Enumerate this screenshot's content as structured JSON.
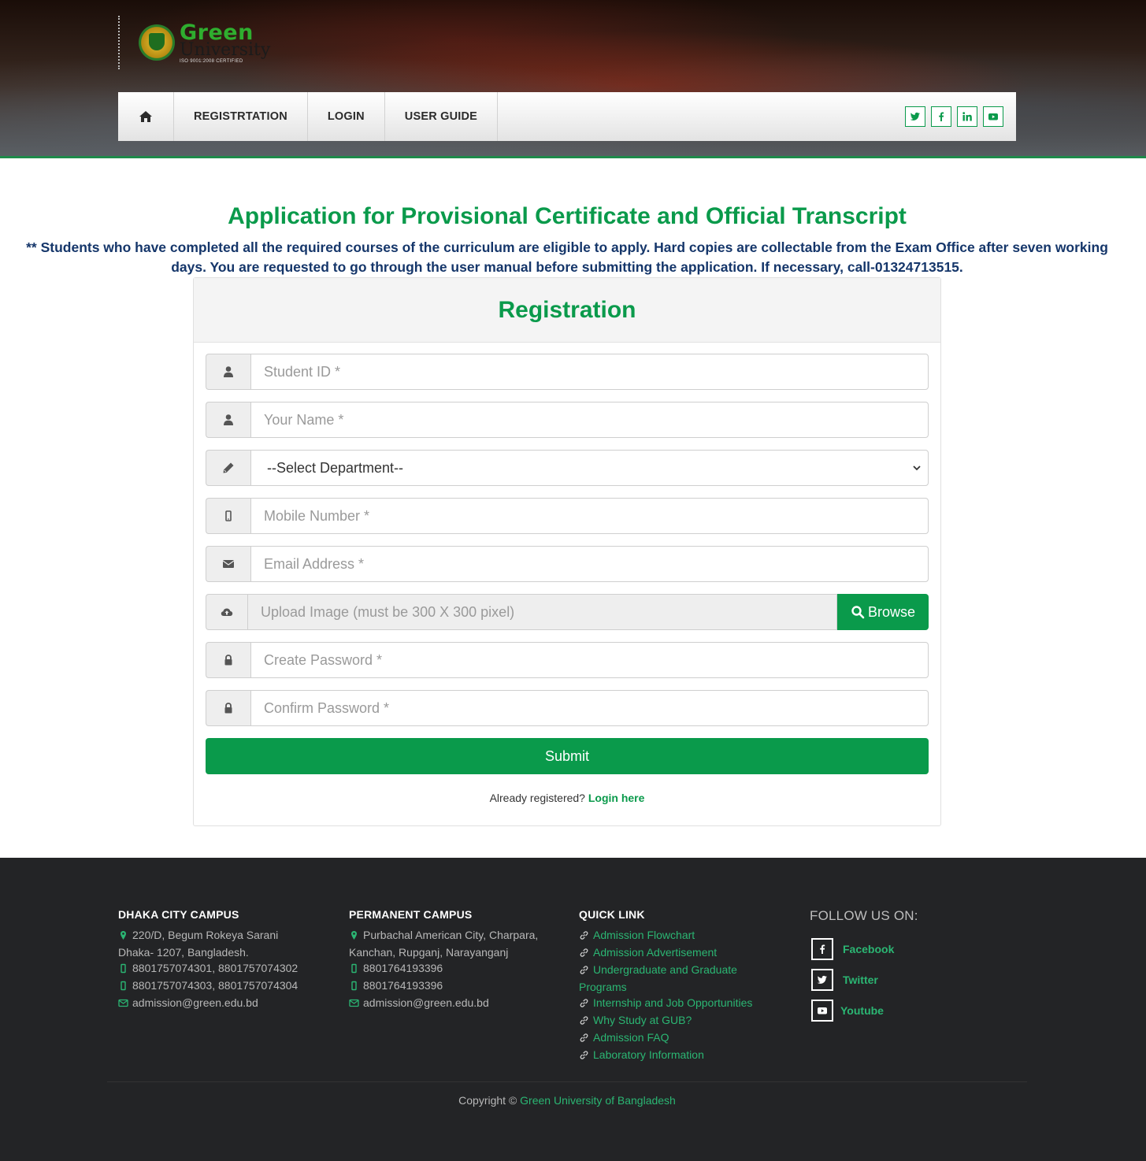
{
  "brand": {
    "logo_line1": "Green",
    "logo_line2": "University",
    "logo_tagline": "ISO 9001:2008 CERTIFIED"
  },
  "nav": {
    "items": [
      {
        "label": "REGISTRTATION"
      },
      {
        "label": "LOGIN"
      },
      {
        "label": "USER GUIDE"
      }
    ],
    "social_icons": [
      "twitter-icon",
      "facebook-icon",
      "linkedin-icon",
      "youtube-icon"
    ]
  },
  "page": {
    "title": "Application for Provisional Certificate and Official Transcript",
    "notice": "** Students who have completed all the required courses of the curriculum are eligible to apply. Hard copies are collectable from the Exam Office after seven working days. You are requested to go through the user manual before submitting the application. If necessary, call-01324713515."
  },
  "form": {
    "heading": "Registration",
    "student_id_placeholder": "Student ID *",
    "name_placeholder": "Your Name *",
    "department_selected": "--Select Department--",
    "mobile_placeholder": "Mobile Number *",
    "email_placeholder": "Email Address *",
    "upload_placeholder": "Upload Image (must be 300 X 300 pixel)",
    "browse_label": "Browse",
    "password_placeholder": "Create Password *",
    "confirm_placeholder": "Confirm Password *",
    "submit_label": "Submit",
    "already_text": "Already registered?",
    "login_link": "Login here"
  },
  "footer": {
    "dhaka": {
      "heading": "DHAKA CITY CAMPUS",
      "address1": "220/D, Begum Rokeya Sarani",
      "address2": "Dhaka- 1207, Bangladesh.",
      "phone1": "8801757074301, 8801757074302",
      "phone2": "8801757074303, 8801757074304",
      "email": "admission@green.edu.bd"
    },
    "permanent": {
      "heading": "PERMANENT CAMPUS",
      "address1": "Purbachal American City, Charpara,",
      "address2": "Kanchan, Rupganj, Narayanganj",
      "phone1": "8801764193396",
      "phone2": "8801764193396",
      "email": "admission@green.edu.bd"
    },
    "quick": {
      "heading": "QUICK LINK",
      "links": [
        "Admission Flowchart",
        "Admission Advertisement",
        "Undergraduate and Graduate",
        "Programs",
        "Internship and Job Opportunities",
        "Why Study at GUB?",
        "Admission FAQ",
        "Laboratory Information"
      ]
    },
    "follow": {
      "heading": "FOLLOW US ON:",
      "facebook": "Facebook",
      "twitter": "Twitter",
      "youtube": "Youtube"
    },
    "copyright_prefix": "Copyright ©",
    "copyright_link": "Green University of Bangladesh"
  },
  "colors": {
    "brand_green": "#0a9a4b",
    "notice_navy": "#15366a",
    "footer_bg": "#232426",
    "footer_link": "#2bb673"
  }
}
